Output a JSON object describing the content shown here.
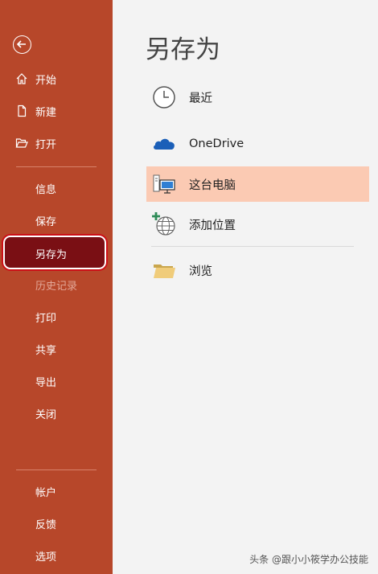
{
  "page_title": "另存为",
  "sidebar": {
    "nav_top": [
      {
        "label": "开始",
        "icon": "home-icon"
      },
      {
        "label": "新建",
        "icon": "new-document-icon"
      },
      {
        "label": "打开",
        "icon": "folder-open-icon"
      }
    ],
    "nav_middle": [
      {
        "label": "信息"
      },
      {
        "label": "保存"
      },
      {
        "label": "另存为"
      },
      {
        "label": "历史记录"
      },
      {
        "label": "打印"
      },
      {
        "label": "共享"
      },
      {
        "label": "导出"
      },
      {
        "label": "关闭"
      }
    ],
    "nav_bottom": [
      {
        "label": "帐户"
      },
      {
        "label": "反馈"
      },
      {
        "label": "选项"
      }
    ],
    "bg_color": "#b7472a",
    "selected_color": "#7a0f14",
    "highlight_ring": "#cc0f16"
  },
  "locations": [
    {
      "label": "最近",
      "icon": "clock-icon"
    },
    {
      "label": "OneDrive",
      "icon": "cloud-icon"
    },
    {
      "label": "这台电脑",
      "icon": "computer-icon",
      "active": true
    },
    {
      "label": "添加位置",
      "icon": "add-location-globe-icon"
    },
    {
      "label": "浏览",
      "icon": "folder-icon"
    }
  ],
  "active_color": "#fbcab3",
  "watermark": "头条 @跟小小筱学办公技能"
}
